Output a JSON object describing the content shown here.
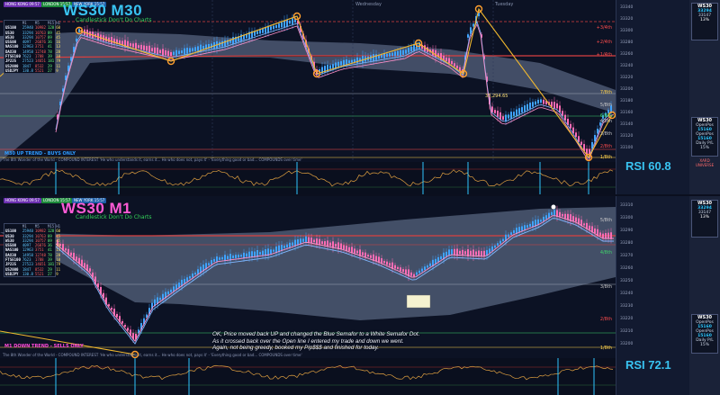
{
  "top_chart": {
    "symbol_timeframe": "WS30 M30",
    "tagline": "Candlestick Don't Do Charts",
    "sessions": [
      {
        "label": "HONG KONG 09:57",
        "color": "#6b2fb0"
      },
      {
        "label": "LONDON 15:57",
        "color": "#1c8a3a"
      },
      {
        "label": "NEW YORK 15:57",
        "color": "#1c5ea8"
      }
    ],
    "day_labels": [
      "Wednesday",
      "Tuesday"
    ],
    "trend_label": "M30 UP TREND - BUYS ONLY",
    "trend_color": "#2f9bff",
    "ticker_text": "The 8th Wonder of the World - COMPOUND INTEREST 'He who understands it, earns it... He who does not, pays it' - 'Everything good or bad... COMPOUNDS over time'",
    "pivots": [
      {
        "label": "+3/4th",
        "color": "#ff4d4d"
      },
      {
        "label": "+2/4th",
        "color": "#ff4d4d"
      },
      {
        "label": "+1/4th",
        "color": "#ff4d4d"
      },
      {
        "label": "7/8th",
        "color": "#ffd24d"
      },
      {
        "label": "6/8th",
        "color": "#3fd46a"
      },
      {
        "label": "5/8th",
        "color": "#c9c9c9"
      },
      {
        "label": "4/8th",
        "color": "#c9c9c9"
      },
      {
        "label": "3/8th",
        "color": "#c9c9c9"
      },
      {
        "label": "2/8th",
        "color": "#ff4d4d"
      },
      {
        "label": "1/8th",
        "color": "#ffd24d"
      }
    ],
    "rsi_label": "RSI 60.8",
    "price_marker": "33,294.65"
  },
  "bottom_chart": {
    "symbol_timeframe": "WS30 M1",
    "tagline": "Candlestick Don't Do Charts",
    "sessions": [
      {
        "label": "HONG KONG 09:57",
        "color": "#6b2fb0"
      },
      {
        "label": "LONDON 15:57",
        "color": "#1c8a3a"
      },
      {
        "label": "NEW YORK 15:57",
        "color": "#1c5ea8"
      }
    ],
    "trend_label": "M1 DOWN TREND - SELLS ONLY",
    "trend_color": "#ff4ad8",
    "ticker_text": "The 8th Wonder of the World - COMPOUND INTEREST 'He who understands it, earns it... He who does not, pays it' - 'Everything good or bad... COMPOUNDS over time'",
    "pivots": [
      {
        "label": "5/8th",
        "color": "#c9c9c9"
      },
      {
        "label": "4/8th",
        "color": "#3fd46a"
      },
      {
        "label": "3/8th",
        "color": "#c9c9c9"
      },
      {
        "label": "2/8th",
        "color": "#ff4d4d"
      },
      {
        "label": "1/8th",
        "color": "#ffd24d"
      }
    ],
    "rsi_label": "RSI 72.1",
    "note_lines": [
      "OK, Price moved back UP and changed the Blue Semafor to a White Semafor Dot.",
      "As it crossed back over the Open line I entered my trade and down we went.",
      "Again, not being greedy, booked my Pip$$$ and finished for today."
    ]
  },
  "dashboard": {
    "header": [
      "",
      "M1",
      "M5",
      "M15",
      "H1"
    ],
    "rows": [
      {
        "name": "US100",
        "v": [
          "25940",
          "10982",
          "128",
          "60"
        ]
      },
      {
        "name": "US30",
        "v": [
          "33294",
          "10763",
          "89",
          "45"
        ]
      },
      {
        "name": "WS30",
        "v": [
          "33294",
          "10757",
          "89",
          "45"
        ]
      },
      {
        "name": "US500",
        "v": [
          "4097",
          "26076",
          "36",
          "16"
        ]
      },
      {
        "name": "NAS100",
        "v": [
          "12963",
          "3751",
          "41",
          "13"
        ]
      },
      {
        "name": "DAX30",
        "v": [
          "14958",
          "12748",
          "78",
          "28"
        ]
      },
      {
        "name": "FTSE100",
        "v": [
          "7623",
          "1788",
          "39",
          "10"
        ]
      },
      {
        "name": "JP225",
        "v": [
          "27523",
          "14651",
          "181",
          "79"
        ]
      },
      {
        "name": "US2000",
        "v": [
          "1847",
          "8532",
          "29",
          "11"
        ]
      },
      {
        "name": "USDJPY",
        "v": [
          "130.8",
          "5521",
          "27",
          "9"
        ]
      }
    ]
  },
  "side_panel": {
    "top_box": {
      "title": "WS30",
      "value": "33294",
      "sub": "33147",
      "pct": "13%"
    },
    "mid_box": {
      "title": "WS30",
      "lines": [
        "OpenPos",
        "15160",
        "OpenPos",
        "15160",
        "Daily P/L",
        "15%"
      ]
    },
    "broker": "XARD UNIVERSE",
    "bottom_box": {
      "title": "WS30",
      "value": "33294",
      "sub": "33147",
      "pct": "13%"
    },
    "bottom_mid": {
      "title": "WS30",
      "lines": [
        "OpenPos",
        "15160",
        "OpenPos",
        "15160",
        "Daily P/L",
        "15%"
      ]
    }
  },
  "price_axis_top": [
    "33340",
    "33320",
    "33300",
    "33280",
    "33260",
    "33240",
    "33220",
    "33200",
    "33180",
    "33160",
    "33140",
    "33120",
    "33100"
  ],
  "price_axis_bottom": [
    "33310",
    "33300",
    "33290",
    "33280",
    "33270",
    "33260",
    "33250",
    "33240",
    "33230",
    "33220",
    "33210",
    "33200"
  ],
  "colors": {
    "bg": "#0c1224",
    "cloud": "#5b6b86",
    "bull": "#3fa3ff",
    "bear": "#ff6cb5",
    "zigzag": "#f2b92e",
    "semafor": "#ff9f2e"
  }
}
